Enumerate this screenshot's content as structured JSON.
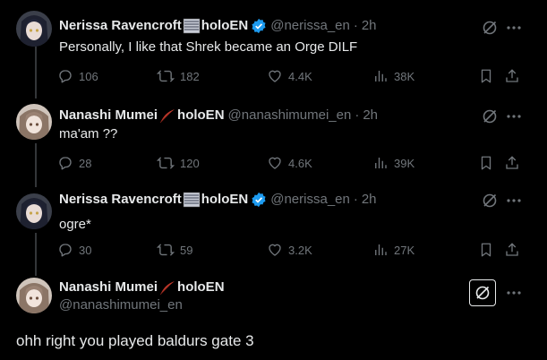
{
  "tweets": [
    {
      "name": "Nerissa Ravencroft",
      "name_suffix": "holoEN",
      "emoji": "sheet-music-emoji",
      "verified": true,
      "handle": "@nerissa_en",
      "time": "2h",
      "text": "Personally, I like that Shrek became an Orge DILF",
      "replies": "106",
      "retweets": "182",
      "likes": "4.4K",
      "views": "38K"
    },
    {
      "name": "Nanashi Mumei",
      "name_suffix": "holoEN",
      "emoji": "feather-emoji",
      "verified": false,
      "handle": "@nanashimumei_en",
      "time": "2h",
      "text": "ma'am ??",
      "replies": "28",
      "retweets": "120",
      "likes": "4.6K",
      "views": "39K"
    },
    {
      "name": "Nerissa Ravencroft",
      "name_suffix": "holoEN",
      "emoji": "sheet-music-emoji",
      "verified": true,
      "handle": "@nerissa_en",
      "time": "2h",
      "text": "ogre*",
      "replies": "30",
      "retweets": "59",
      "likes": "3.2K",
      "views": "27K"
    }
  ],
  "main_tweet": {
    "name": "Nanashi Mumei",
    "name_suffix": "holoEN",
    "emoji": "feather-emoji",
    "handle": "@nanashimumei_en",
    "text": "ohh right you played baldurs gate 3"
  },
  "dot": "·",
  "colors": {
    "background": "#000000",
    "text": "#e7e9ea",
    "muted": "#71767b",
    "verified": "#1d9bf0",
    "thread_line": "#333639"
  }
}
